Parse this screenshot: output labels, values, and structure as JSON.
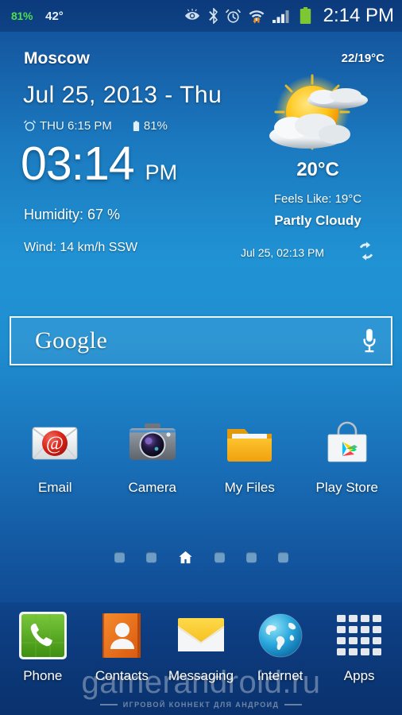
{
  "statusbar": {
    "battery_percent": "81%",
    "cpu_temp": "42°",
    "clock": "2:14 PM",
    "icons": [
      "smart-stay-eye-icon",
      "bluetooth-icon",
      "alarm-clock-icon",
      "wifi-icon",
      "signal-bars-icon",
      "battery-icon"
    ],
    "battery_color": "#7dc832",
    "battery_pct_color": "#4ede4e"
  },
  "weather_widget": {
    "city": "Moscow",
    "high_low": "22/19°C",
    "date": "Jul 25, 2013 - Thu",
    "alarm_time": "THU 6:15 PM",
    "battery": "81%",
    "clock_time": "03:14",
    "clock_ampm": "PM",
    "humidity": "Humidity: 67 %",
    "wind": "Wind: 14 km/h SSW",
    "temperature": "20°C",
    "feels_like": "Feels Like: 19°C",
    "condition": "Partly Cloudy",
    "updated": "Jul 25, 02:13 PM",
    "weather_icon": "sun-behind-clouds-icon",
    "refresh_icon": "refresh-icon"
  },
  "search": {
    "logo_text": "Google",
    "mic_icon": "microphone-icon"
  },
  "apps": [
    {
      "label": "Email",
      "icon": "email-envelope-icon"
    },
    {
      "label": "Camera",
      "icon": "camera-icon"
    },
    {
      "label": "My Files",
      "icon": "folder-icon"
    },
    {
      "label": "Play Store",
      "icon": "play-store-bag-icon"
    }
  ],
  "page_indicator": {
    "count": 6,
    "active_index": 2,
    "active_icon": "home-icon"
  },
  "dock": [
    {
      "label": "Phone",
      "icon": "phone-handset-icon"
    },
    {
      "label": "Contacts",
      "icon": "contacts-person-icon"
    },
    {
      "label": "Messaging",
      "icon": "messaging-envelope-icon"
    },
    {
      "label": "Internet",
      "icon": "globe-icon"
    },
    {
      "label": "Apps",
      "icon": "apps-grid-icon"
    }
  ],
  "watermark": {
    "main": "gamerandroid.ru",
    "sub": "ИГРОВОЙ КОННЕКТ ДЛЯ АНДРОИД"
  },
  "colors": {
    "background_top": "#0e3f82",
    "background_mid": "#1f8ed0",
    "background_bottom": "#0d3d80",
    "accent_green": "#7dc832",
    "folder_orange": "#f5a623",
    "contacts_orange": "#e8701a",
    "phone_green": "#5eae1e"
  }
}
